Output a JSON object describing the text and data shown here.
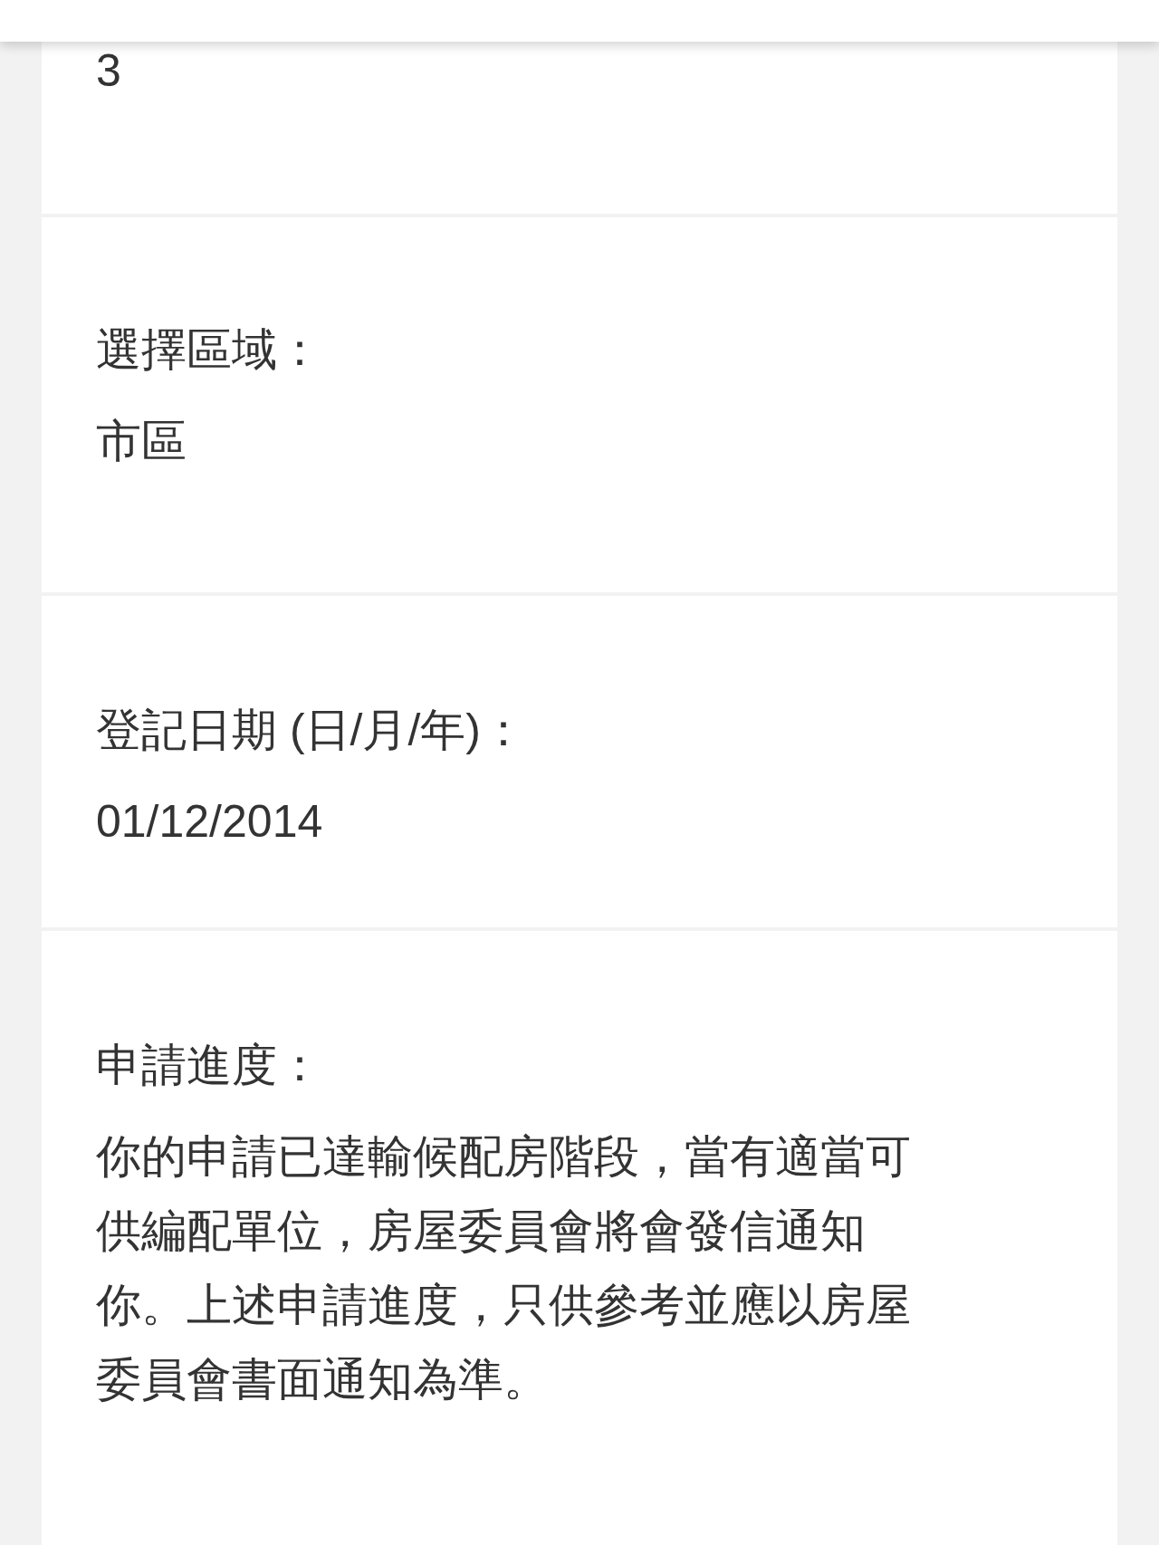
{
  "fields": [
    {
      "value": "3"
    },
    {
      "label": "選擇區域：",
      "value": "市區"
    },
    {
      "label": "登記日期 (日/月/年)：",
      "value": "01/12/2014"
    },
    {
      "label": "申請進度：",
      "value": "你的申請已達輸候配房階段，當有適當可供編配單位，房屋委員會將會發信通知你。上述申請進度，只供參考並應以房屋委員會書面通知為準。"
    }
  ]
}
